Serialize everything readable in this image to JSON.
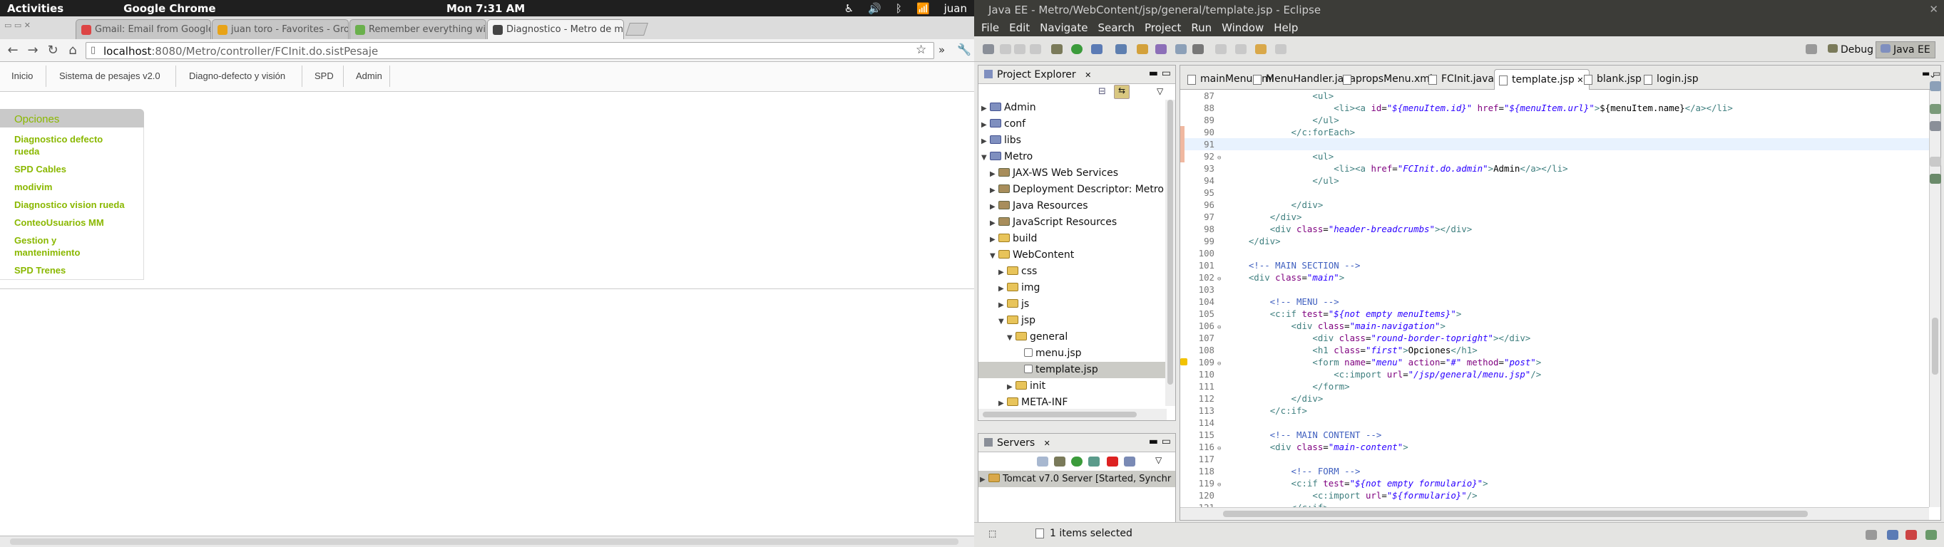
{
  "topbar": {
    "activities": "Activities",
    "app_name": "Google Chrome",
    "clock": "Mon  7:31 AM",
    "user": "juan"
  },
  "chrome": {
    "tabs": [
      {
        "label": "Gmail: Email from Google",
        "color": "#d44"
      },
      {
        "label": "juan toro - Favorites - Gro",
        "color": "#e8a317"
      },
      {
        "label": "Remember everything wi",
        "color": "#6ab04c"
      },
      {
        "label": "Diagnostico - Metro de m",
        "color": "#444"
      }
    ],
    "url_host": "localhost",
    "url_rest": ":8080/Metro/controller/FCInit.do.sistPesaje"
  },
  "web": {
    "nav": [
      "Inicio",
      "Sistema de pesajes v2.0",
      "Diagno-defecto y visión",
      "SPD",
      "Admin"
    ],
    "menu_title": "Opciones",
    "menu_items": [
      "Diagnostico defecto rueda",
      "SPD Cables",
      "modivim",
      "Diagnostico vision rueda",
      "ConteoUsuarios MM",
      "Gestion y mantenimiento",
      "SPD Trenes"
    ]
  },
  "eclipse": {
    "title": "Java EE - Metro/WebContent/jsp/general/template.jsp - Eclipse",
    "menu": [
      "File",
      "Edit",
      "Navigate",
      "Search",
      "Project",
      "Run",
      "Window",
      "Help"
    ],
    "perspectives": [
      "Debug",
      "Java EE"
    ],
    "project_explorer_title": "Project Explorer",
    "servers_title": "Servers",
    "server_row": "Tomcat v7.0 Server  [Started, Synchr",
    "tree": [
      {
        "label": "Admin",
        "depth": 0,
        "icon": "proj",
        "exp": false
      },
      {
        "label": "conf",
        "depth": 0,
        "icon": "proj",
        "exp": false
      },
      {
        "label": "libs",
        "depth": 0,
        "icon": "proj",
        "exp": false
      },
      {
        "label": "Metro",
        "depth": 0,
        "icon": "proj",
        "exp": true
      },
      {
        "label": "JAX-WS Web Services",
        "depth": 1,
        "icon": "pkg",
        "exp": false
      },
      {
        "label": "Deployment Descriptor: Metro",
        "depth": 1,
        "icon": "pkg",
        "exp": false
      },
      {
        "label": "Java Resources",
        "depth": 1,
        "icon": "pkg",
        "exp": false
      },
      {
        "label": "JavaScript Resources",
        "depth": 1,
        "icon": "pkg",
        "exp": false
      },
      {
        "label": "build",
        "depth": 1,
        "icon": "fold",
        "exp": false
      },
      {
        "label": "WebContent",
        "depth": 1,
        "icon": "fold",
        "exp": true
      },
      {
        "label": "css",
        "depth": 2,
        "icon": "fold",
        "exp": false
      },
      {
        "label": "img",
        "depth": 2,
        "icon": "fold",
        "exp": false
      },
      {
        "label": "js",
        "depth": 2,
        "icon": "fold",
        "exp": false
      },
      {
        "label": "jsp",
        "depth": 2,
        "icon": "fold",
        "exp": true
      },
      {
        "label": "general",
        "depth": 3,
        "icon": "fold",
        "exp": true
      },
      {
        "label": "menu.jsp",
        "depth": 4,
        "icon": "file",
        "exp": null
      },
      {
        "label": "template.jsp",
        "depth": 4,
        "icon": "file",
        "exp": null,
        "sel": true
      },
      {
        "label": "init",
        "depth": 3,
        "icon": "fold",
        "exp": false
      },
      {
        "label": "META-INF",
        "depth": 2,
        "icon": "fold",
        "exp": false
      }
    ],
    "editor_tabs": [
      "mainMenu.xml",
      "MenuHandler.java",
      "propsMenu.xml",
      "FCInit.java",
      "template.jsp",
      "blank.jsp",
      "login.jsp"
    ],
    "active_tab": 4,
    "code": [
      {
        "n": "87",
        "t": "                <ul>"
      },
      {
        "n": "88",
        "t": "                    <li><a id=\"${menuItem.id}\" href=\"${menuItem.url}\">${menuItem.name}</a></li>"
      },
      {
        "n": "89",
        "t": "                </ul>"
      },
      {
        "n": "90",
        "t": "            </c:forEach>"
      },
      {
        "n": "91",
        "t": "",
        "cur": true
      },
      {
        "n": "92",
        "t": "                <ul>"
      },
      {
        "n": "93",
        "t": "                    <li><a href=\"FCInit.do.admin\">Admin</a></li>"
      },
      {
        "n": "94",
        "t": "                </ul>"
      },
      {
        "n": "95",
        "t": ""
      },
      {
        "n": "96",
        "t": "            </div>"
      },
      {
        "n": "97",
        "t": "        </div>"
      },
      {
        "n": "98",
        "t": "        <div class=\"header-breadcrumbs\"></div>"
      },
      {
        "n": "99",
        "t": "    </div>"
      },
      {
        "n": "100",
        "t": ""
      },
      {
        "n": "101",
        "t": "    <!-- MAIN SECTION -->"
      },
      {
        "n": "102",
        "t": "    <div class=\"main\">"
      },
      {
        "n": "103",
        "t": ""
      },
      {
        "n": "104",
        "t": "        <!-- MENU -->"
      },
      {
        "n": "105",
        "t": "        <c:if test=\"${not empty menuItems}\">"
      },
      {
        "n": "106",
        "t": "            <div class=\"main-navigation\">"
      },
      {
        "n": "107",
        "t": "                <div class=\"round-border-topright\"></div>"
      },
      {
        "n": "108",
        "t": "                <h1 class=\"first\">Opciones</h1>"
      },
      {
        "n": "109",
        "t": "                <form name=\"menu\" action=\"#\" method=\"post\">"
      },
      {
        "n": "110",
        "t": "                    <c:import url=\"/jsp/general/menu.jsp\"/>"
      },
      {
        "n": "111",
        "t": "                </form>"
      },
      {
        "n": "112",
        "t": "            </div>"
      },
      {
        "n": "113",
        "t": "        </c:if>"
      },
      {
        "n": "114",
        "t": ""
      },
      {
        "n": "115",
        "t": "        <!-- MAIN CONTENT -->"
      },
      {
        "n": "116",
        "t": "        <div class=\"main-content\">"
      },
      {
        "n": "117",
        "t": ""
      },
      {
        "n": "118",
        "t": "            <!-- FORM -->"
      },
      {
        "n": "119",
        "t": "            <c:if test=\"${not empty formulario}\">"
      },
      {
        "n": "120",
        "t": "                <c:import url=\"${formulario}\"/>"
      },
      {
        "n": "121",
        "t": "            </c:if>"
      }
    ],
    "status_text": "1 items selected"
  }
}
